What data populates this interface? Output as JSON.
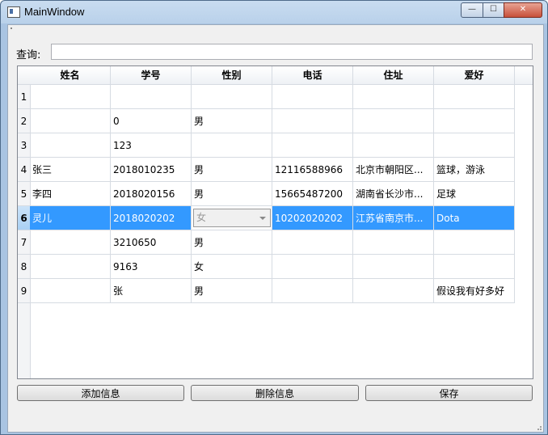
{
  "window": {
    "title": "MainWindow",
    "minimize": "—",
    "maximize": "☐",
    "close": "✕"
  },
  "query": {
    "label": "查询:",
    "value": ""
  },
  "table": {
    "columns": [
      "姓名",
      "学号",
      "性别",
      "电话",
      "住址",
      "爱好"
    ],
    "row_numbers": [
      "1",
      "2",
      "3",
      "4",
      "5",
      "6",
      "7",
      "8",
      "9"
    ],
    "selected_row": 6,
    "rows": [
      [
        "",
        "",
        "",
        "",
        "",
        ""
      ],
      [
        "",
        "0",
        "男",
        "",
        "",
        ""
      ],
      [
        "",
        "123",
        "",
        "",
        "",
        ""
      ],
      [
        "张三",
        "2018010235",
        "男",
        "12116588966",
        "北京市朝阳区...",
        "篮球，游泳"
      ],
      [
        "李四",
        "2018020156",
        "男",
        "15665487200",
        "湖南省长沙市...",
        "足球"
      ],
      [
        "灵儿",
        "2018020202",
        "女",
        "10202020202",
        "江苏省南京市...",
        "Dota"
      ],
      [
        "",
        "3210650",
        "男",
        "",
        "",
        ""
      ],
      [
        "",
        "9163",
        "女",
        "",
        "",
        ""
      ],
      [
        "",
        "张",
        "男",
        "",
        "",
        "假设我有好多好"
      ]
    ]
  },
  "buttons": {
    "add": "添加信息",
    "delete": "删除信息",
    "save": "保存"
  },
  "colors": {
    "selection": "#3399ff",
    "titlebar": "#b9d1ea"
  }
}
